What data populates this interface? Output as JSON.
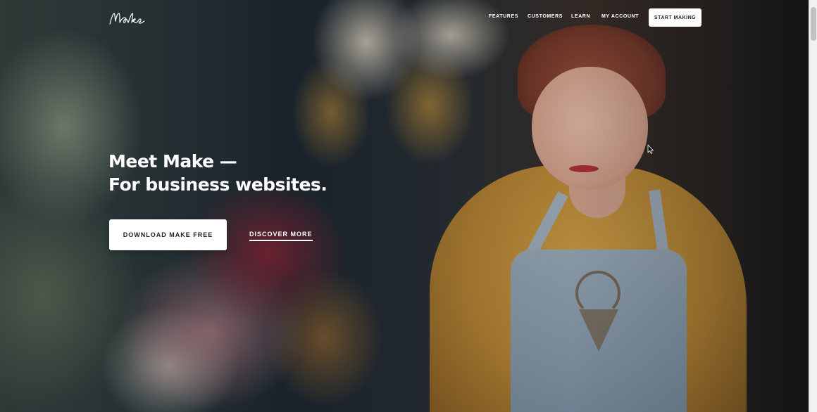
{
  "header": {
    "logo_text": "Make",
    "nav": [
      {
        "label": "FEATURES"
      },
      {
        "label": "CUSTOMERS"
      },
      {
        "label": "LEARN"
      },
      {
        "label": "MY ACCOUNT"
      }
    ],
    "cta_label": "START MAKING"
  },
  "hero": {
    "title_line1": "Meet Make —",
    "title_line2": "For business websites.",
    "primary_button": "DOWNLOAD MAKE FREE",
    "secondary_link": "DISCOVER MORE"
  },
  "icons": {
    "logo": "make-script-logo-icon",
    "cursor": "mouse-pointer-icon"
  }
}
